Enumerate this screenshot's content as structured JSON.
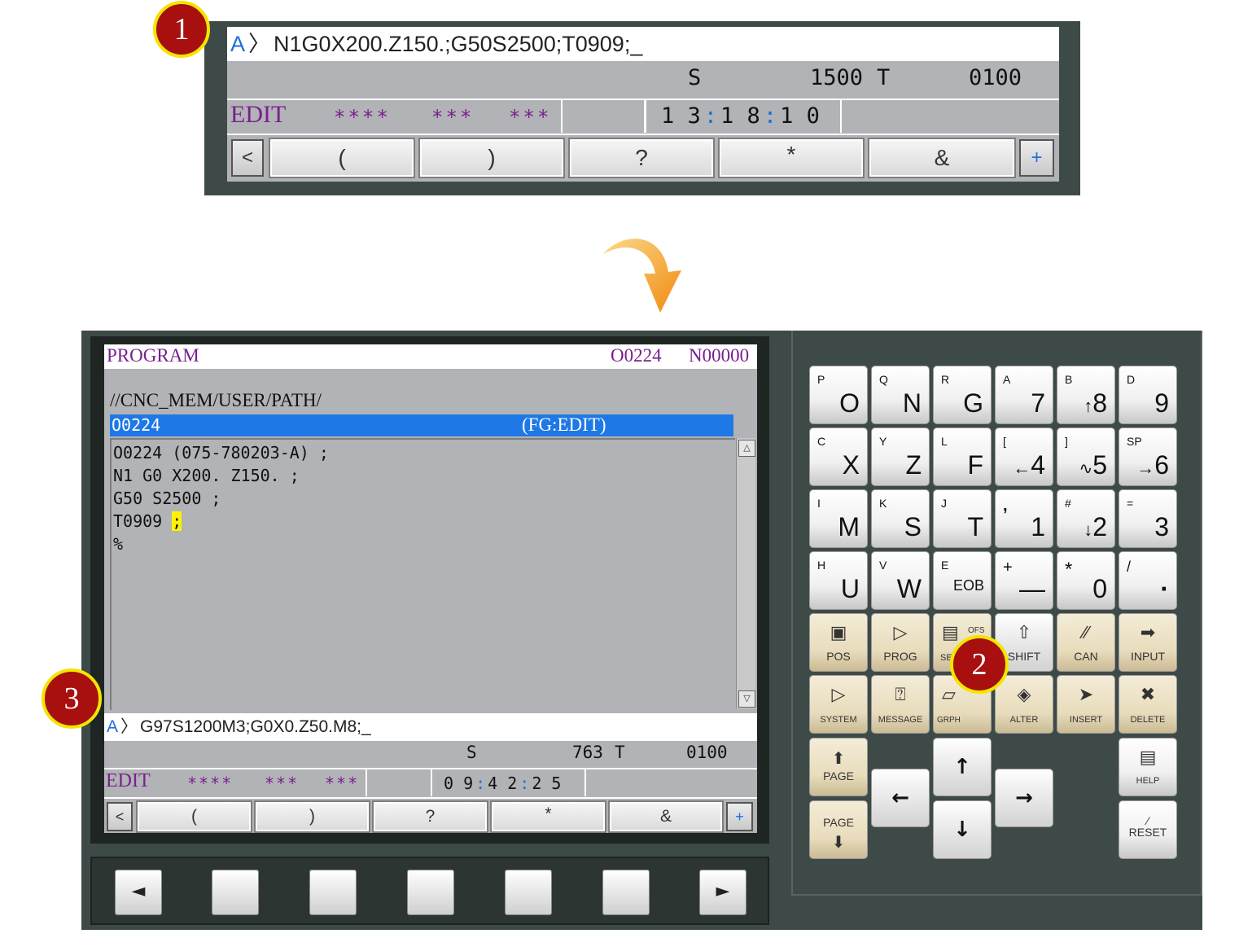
{
  "callouts": {
    "one": "1",
    "two": "2",
    "three": "3"
  },
  "top_screen": {
    "prompt": "A",
    "prompt_arrow": "〉",
    "input_text": "N1G0X200.Z150.;G50S2500;T0909;_",
    "s_label": "S",
    "s_value": "1500",
    "t_label": "T",
    "t_value": "0100",
    "mode": "EDIT",
    "stars1": "****",
    "stars2": "***",
    "stars3": "***",
    "time_h": "1 3",
    "time_m": "1 8",
    "time_s": "1 0",
    "colon": ":",
    "softkeys": [
      "<",
      "(",
      ")",
      "?",
      "*",
      "&",
      "+"
    ]
  },
  "bottom_screen": {
    "title": "PROGRAM",
    "prog_no": "O0224",
    "seq_no": "N00000",
    "path": "//CNC_MEM/USER/PATH/",
    "file_name": "O0224",
    "file_mode": "(FG:EDIT)",
    "code_lines": [
      "O0224 (075-780203-A) ;",
      "N1 G0 X200. Z150. ;",
      "G50 S2500 ;",
      "T0909 ",
      "%"
    ],
    "cursor_char": ";",
    "scroll_up": "△",
    "scroll_down": "▽",
    "prompt": "A",
    "prompt_arrow": "〉",
    "input_text": "G97S1200M3;G0X0.Z50.M8;_",
    "s_label": "S",
    "s_value": "763",
    "t_label": "T",
    "t_value": "0100",
    "mode": "EDIT",
    "stars1": "****",
    "stars2": "***",
    "stars3": "***",
    "time_h": "0 9",
    "time_m": "4 2",
    "time_s": "2 5",
    "colon": ":",
    "softkeys": [
      "<",
      "(",
      ")",
      "?",
      "*",
      "&",
      "+"
    ]
  },
  "hardware_softkeys": [
    "◄",
    "",
    "",
    "",
    "",
    "",
    "►"
  ],
  "keypad": {
    "row1": [
      {
        "sub": "P",
        "main": "O"
      },
      {
        "sub": "Q",
        "main": "N"
      },
      {
        "sub": "R",
        "main": "G"
      },
      {
        "sub": "A",
        "main": "7"
      },
      {
        "sub": "B",
        "main": "8",
        "pre": "↑"
      },
      {
        "sub": "D",
        "main": "9"
      }
    ],
    "row2": [
      {
        "sub": "C",
        "main": "X"
      },
      {
        "sub": "Y",
        "main": "Z"
      },
      {
        "sub": "L",
        "main": "F"
      },
      {
        "sub": "[",
        "main": "4",
        "pre": "←"
      },
      {
        "sub": "]",
        "main": "5",
        "pre": "∿"
      },
      {
        "sub": "SP",
        "main": "6",
        "pre": "→"
      }
    ],
    "row3": [
      {
        "sub": "I",
        "main": "M"
      },
      {
        "sub": "K",
        "main": "S"
      },
      {
        "sub": "J",
        "main": "T"
      },
      {
        "sub": ",",
        "main": "1"
      },
      {
        "sub": "#",
        "main": "2",
        "pre": "↓"
      },
      {
        "sub": "=",
        "main": "3"
      }
    ],
    "row4": [
      {
        "sub": "H",
        "main": "U"
      },
      {
        "sub": "V",
        "main": "W"
      },
      {
        "sub": "E",
        "main": "EOB"
      },
      {
        "sub": "+",
        "main": "—"
      },
      {
        "sub": "*",
        "main": "0"
      },
      {
        "sub": "/",
        "main": "·"
      }
    ],
    "fn_row1": [
      "POS",
      "PROG",
      "SE",
      "SHIFT",
      "CAN",
      "INPUT"
    ],
    "ofs_label": "OFS",
    "fn_row2": [
      "SYSTEM",
      "MESSAGE",
      "GRPH",
      "ALTER",
      "INSERT",
      "DELETE"
    ],
    "page_up": "PAGE",
    "page_down": "PAGE",
    "help": "HELP",
    "reset": "RESET",
    "arrows": {
      "up": "↑",
      "down": "↓",
      "left": "←",
      "right": "→"
    }
  },
  "colors": {
    "accent_blue": "#1e78e6",
    "mode_purple": "#7a1f8e",
    "callout_red": "#a80f0f",
    "callout_ring": "#f2e600",
    "body_dark": "#3e4a47"
  }
}
